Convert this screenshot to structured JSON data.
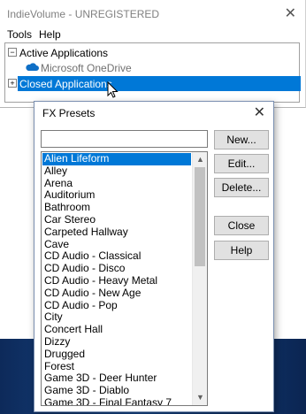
{
  "app": {
    "title": "IndieVolume - UNREGISTERED",
    "close_glyph": "✕",
    "menu": [
      "Tools",
      "Help"
    ]
  },
  "tree": {
    "active_label": "Active Applications",
    "active_expander": "−",
    "active_children": [
      "Microsoft OneDrive"
    ],
    "closed_label": "Closed Applications",
    "closed_expander": "+"
  },
  "dialog": {
    "title": "FX Presets",
    "close_glyph": "✕",
    "name_input_value": "",
    "buttons": {
      "new": "New...",
      "edit": "Edit...",
      "delete": "Delete...",
      "close": "Close",
      "help": "Help"
    },
    "presets": [
      "Alien Lifeform",
      "Alley",
      "Arena",
      "Auditorium",
      "Bathroom",
      "Car Stereo",
      "Carpeted Hallway",
      "Cave",
      "CD Audio - Classical",
      "CD Audio - Disco",
      "CD Audio - Heavy Metal",
      "CD Audio - New Age",
      "CD Audio - Pop",
      "City",
      "Concert Hall",
      "Dizzy",
      "Drugged",
      "Forest",
      "Game 3D - Deer Hunter",
      "Game 3D - Diablo",
      "Game 3D - Final Fantasy 7"
    ],
    "selected_preset": "Alien Lifeform",
    "scroll_up_glyph": "▲",
    "scroll_down_glyph": "▼"
  },
  "colors": {
    "selection": "#0078d7",
    "onedrive_cloud": "#0f6fc6",
    "desktop": "#1a4b8e"
  },
  "icons": {
    "cloud": "onedrive-cloud-icon",
    "pointer": "mouse-pointer-icon"
  }
}
